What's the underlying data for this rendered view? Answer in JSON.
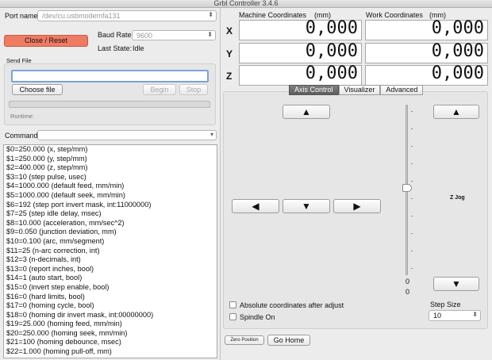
{
  "window": {
    "title": "Grbl Controller 3.4.6"
  },
  "connection": {
    "port_label": "Port name",
    "port_value": "/dev/cu.usbmodemfa131",
    "close_reset": "Close / Reset",
    "baud_label": "Baud Rate",
    "baud_value": "9600",
    "state_label": "Last State:",
    "state_value": "Idle"
  },
  "send_file": {
    "group_label": "Send File",
    "path_value": "",
    "choose_file": "Choose file",
    "begin": "Begin",
    "stop": "Stop",
    "progress": 0,
    "runtime_label": "Runtime:"
  },
  "command": {
    "label": "Command",
    "value": ""
  },
  "console_lines": [
    "$0=250.000 (x, step/mm)",
    "$1=250.000 (y, step/mm)",
    "$2=400.000 (z, step/mm)",
    "$3=10 (step pulse, usec)",
    "$4=1000.000 (default feed, mm/min)",
    "$5=1000.000 (default seek, mm/min)",
    "$6=192 (step port invert mask, int:11000000)",
    "$7=25 (step idle delay, msec)",
    "$8=10.000 (acceleration, mm/sec^2)",
    "$9=0.050 (junction deviation, mm)",
    "$10=0.100 (arc, mm/segment)",
    "$11=25 (n-arc correction, int)",
    "$12=3 (n-decimals, int)",
    "$13=0 (report inches, bool)",
    "$14=1 (auto start, bool)",
    "$15=0 (invert step enable, bool)",
    "$16=0 (hard limits, bool)",
    "$17=0 (homing cycle, bool)",
    "$18=0 (homing dir invert mask, int:00000000)",
    "$19=25.000 (homing feed, mm/min)",
    "$20=250.000 (homing seek, mm/min)",
    "$21=100 (homing debounce, msec)",
    "$22=1.000 (homing pull-off, mm)"
  ],
  "coordinates": {
    "machine_label": "Machine Coordinates",
    "machine_unit": "(mm)",
    "work_label": "Work Coordinates",
    "work_unit": "(mm)",
    "axes": [
      {
        "name": "X",
        "machine": "0,000",
        "work": "0,000"
      },
      {
        "name": "Y",
        "machine": "0,000",
        "work": "0,000"
      },
      {
        "name": "Z",
        "machine": "0,000",
        "work": "0,000"
      }
    ]
  },
  "tabs": [
    {
      "label": "Axis Control",
      "active": true
    },
    {
      "label": "Visualizer",
      "active": false
    },
    {
      "label": "Advanced",
      "active": false
    }
  ],
  "jog": {
    "up_glyph": "▲",
    "down_glyph": "▼",
    "left_glyph": "◀",
    "right_glyph": "▶",
    "z_up_glyph": "▲",
    "z_down_glyph": "▼",
    "z_label": "Z Jog",
    "slider_value_1": "0",
    "slider_value_2": "0",
    "absolute_label": "Absolute coordinates after adjust",
    "absolute_checked": false,
    "spindle_label": "Spindle On",
    "spindle_checked": false,
    "step_size_label": "Step Size",
    "step_size_value": "10"
  },
  "footer": {
    "zero_position": "Zero Position",
    "go_home": "Go Home"
  }
}
